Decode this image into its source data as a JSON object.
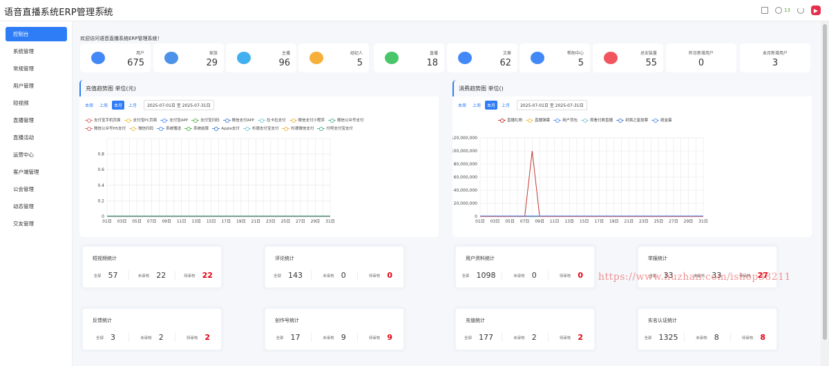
{
  "app": {
    "title": "语音直播系统ERP管理系统",
    "notif_count": "13",
    "avatar_text": "▶"
  },
  "sidebar": {
    "items": [
      "控制台",
      "系统管理",
      "常规管理",
      "用户管理",
      "短视频",
      "直播管理",
      "直播活动",
      "运营中心",
      "客户端管理",
      "公会管理",
      "动态管理",
      "交友管理"
    ]
  },
  "welcome": "欢迎访问语音直播系统ERP管理系统！",
  "stats": [
    {
      "label": "用户",
      "value": "675",
      "icon": "users-icon",
      "color": "#2e7cf6"
    },
    {
      "label": "家族",
      "value": "29",
      "icon": "family-icon",
      "color": "#3a86e8"
    },
    {
      "label": "主播",
      "value": "96",
      "icon": "chat-icon",
      "color": "#2ea6f0"
    },
    {
      "label": "经纪人",
      "value": "5",
      "icon": "coin-icon",
      "color": "#f5a623"
    },
    {
      "label": "直播",
      "value": "18",
      "icon": "live-icon",
      "color": "#36c05a"
    },
    {
      "label": "文章",
      "value": "62",
      "icon": "tv-icon",
      "color": "#2e7cf6"
    },
    {
      "label": "帮助中心",
      "value": "5",
      "icon": "megaphone-icon",
      "color": "#2e7cf6"
    },
    {
      "label": "总安装量",
      "value": "55",
      "icon": "install-icon",
      "color": "#f0424c"
    },
    {
      "label": "昨日新增用户",
      "value": "0",
      "icon": "",
      "color": ""
    },
    {
      "label": "本月新增用户",
      "value": "3",
      "icon": "",
      "color": ""
    }
  ],
  "recharge": {
    "title": "充值趋势图 单位(元)",
    "tabs": [
      "本周",
      "上周",
      "本月",
      "上月"
    ],
    "active_tab": "本月",
    "date_range": "2025-07-01日 至 2025-07-31日",
    "legend": [
      {
        "name": "支付宝手机页面",
        "color": "#e06c6c"
      },
      {
        "name": "支付宝PC页面",
        "color": "#f0c14b"
      },
      {
        "name": "支付宝APP",
        "color": "#5b8ff9"
      },
      {
        "name": "支付宝扫码",
        "color": "#5ab552"
      },
      {
        "name": "微信支付APP",
        "color": "#4a7fd1"
      },
      {
        "name": "拉卡拉支付",
        "color": "#7ec9d6"
      },
      {
        "name": "微信支付小程序",
        "color": "#f0b44b"
      },
      {
        "name": "微信公众号支付",
        "color": "#56b38a"
      },
      {
        "name": "微信公众号H5支付",
        "color": "#d46a6a"
      },
      {
        "name": "微信扫码",
        "color": "#f0c14b"
      },
      {
        "name": "系统赠送",
        "color": "#5b8ff9"
      },
      {
        "name": "系统结算",
        "color": "#5ab552"
      },
      {
        "name": "Apple支付",
        "color": "#4a7fd1"
      },
      {
        "name": "杉德支付宝支付",
        "color": "#7ec9d6"
      },
      {
        "name": "杉德微信支付",
        "color": "#f0b44b"
      },
      {
        "name": "付呗支付宝支付",
        "color": "#56b38a"
      }
    ],
    "chart_data": {
      "type": "line",
      "title": "充值趋势图 单位(元)",
      "x": [
        "01日",
        "02日",
        "03日",
        "04日",
        "05日",
        "06日",
        "07日",
        "08日",
        "09日",
        "10日",
        "11日",
        "12日",
        "13日",
        "14日",
        "15日",
        "16日",
        "17日",
        "18日",
        "19日",
        "20日",
        "21日",
        "22日",
        "23日",
        "24日",
        "25日",
        "26日",
        "27日",
        "28日",
        "29日",
        "30日",
        "31日"
      ],
      "xticks": [
        "01日",
        "03日",
        "05日",
        "07日",
        "09日",
        "11日",
        "13日",
        "15日",
        "17日",
        "19日",
        "21日",
        "23日",
        "25日",
        "27日",
        "29日",
        "31日"
      ],
      "yticks": [
        "0",
        "0.2",
        "0.4",
        "0.6",
        "0.8"
      ],
      "ylim": [
        0,
        1
      ],
      "series_values": "all zero"
    }
  },
  "consume": {
    "title": "消费趋势图 单位()",
    "tabs": [
      "本周",
      "上周",
      "本月",
      "上月"
    ],
    "active_tab": "本月",
    "date_range": "2025-07-01日 至 2025-07-31日",
    "legend": [
      {
        "name": "直播礼物",
        "color": "#c23531"
      },
      {
        "name": "直播弹幕",
        "color": "#f0c14b"
      },
      {
        "name": "用户背包",
        "color": "#5b8ff9"
      },
      {
        "name": "观看付费直播",
        "color": "#7ec9d6"
      },
      {
        "name": "封面之星投票",
        "color": "#4a7fd1"
      },
      {
        "name": "砸金蛋",
        "color": "#5b8ff9"
      }
    ],
    "chart_data": {
      "type": "line",
      "title": "消费趋势图 单位()",
      "x": [
        "01日",
        "02日",
        "03日",
        "04日",
        "05日",
        "06日",
        "07日",
        "08日",
        "09日",
        "10日",
        "11日",
        "12日",
        "13日",
        "14日",
        "15日",
        "16日",
        "17日",
        "18日",
        "19日",
        "20日",
        "21日",
        "22日",
        "23日",
        "24日",
        "25日",
        "26日",
        "27日",
        "28日",
        "29日",
        "30日",
        "31日"
      ],
      "xticks": [
        "01日",
        "03日",
        "05日",
        "07日",
        "09日",
        "11日",
        "13日",
        "15日",
        "17日",
        "19日",
        "21日",
        "23日",
        "25日",
        "27日",
        "29日",
        "31日"
      ],
      "yticks": [
        "0",
        "20,000,000",
        "40,000,000",
        "60,000,000",
        "80,000,000",
        "100,000,000",
        "120,000,000"
      ],
      "ylim": [
        0,
        120000000
      ],
      "series": [
        {
          "name": "直播礼物",
          "values": [
            0,
            0,
            0,
            0,
            0,
            500000,
            0,
            100000000,
            0,
            0,
            0,
            0,
            0,
            0,
            0,
            0,
            0,
            0,
            0,
            0,
            0,
            0,
            0,
            0,
            0,
            0,
            0,
            0,
            0,
            0,
            0
          ]
        }
      ]
    }
  },
  "mini_stats": [
    {
      "title": "短视频统计",
      "values": [
        "57",
        "22",
        "22"
      ]
    },
    {
      "title": "评论统计",
      "values": [
        "143",
        "0",
        "0"
      ]
    },
    {
      "title": "用户资料统计",
      "values": [
        "1098",
        "0",
        "0"
      ]
    },
    {
      "title": "举报统计",
      "values": [
        "33",
        "33",
        "27"
      ]
    },
    {
      "title": "反馈统计",
      "values": [
        "3",
        "2",
        "2"
      ]
    },
    {
      "title": "创作号统计",
      "values": [
        "17",
        "9",
        "9"
      ]
    },
    {
      "title": "充值统计",
      "values": [
        "177",
        "2",
        "2"
      ]
    },
    {
      "title": "实名认证统计",
      "values": [
        "1325",
        "8",
        "8"
      ]
    }
  ],
  "mini_labels": [
    "全部",
    "未审核",
    "待审核"
  ],
  "watermark": "https://www.huzhan.com/ishop38211"
}
